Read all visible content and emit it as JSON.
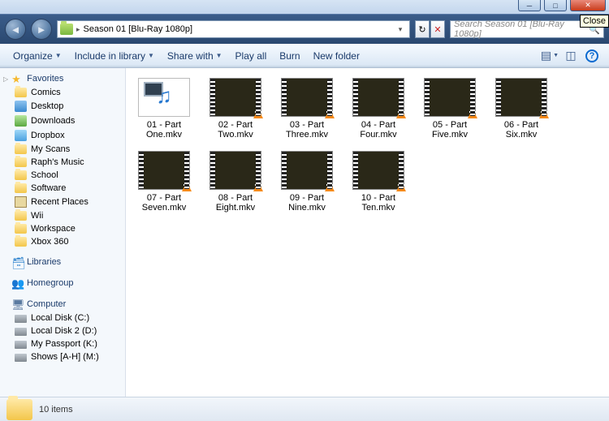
{
  "window": {
    "minimize_glyph": "─",
    "maximize_glyph": "□",
    "close_glyph": "✕",
    "close_tooltip": "Close"
  },
  "address": {
    "nav_back_glyph": "◄",
    "nav_fwd_glyph": "►",
    "path_sep": "▸",
    "current_folder": "Season 01 [Blu-Ray 1080p]",
    "dropdown_glyph": "▾",
    "refresh_glyph": "↻",
    "stop_glyph": "✕",
    "search_placeholder": "Search Season 01 [Blu-Ray 1080p]",
    "search_glyph": "🔍"
  },
  "toolbar": {
    "organize": "Organize",
    "include": "Include in library",
    "share": "Share with",
    "play": "Play all",
    "burn": "Burn",
    "newfolder": "New folder",
    "dd": "▼"
  },
  "sidebar": {
    "favorites": {
      "label": "Favorites",
      "items": [
        {
          "label": "Comics",
          "icon": "fold"
        },
        {
          "label": "Desktop",
          "icon": "desk"
        },
        {
          "label": "Downloads",
          "icon": "dl"
        },
        {
          "label": "Dropbox",
          "icon": "box"
        },
        {
          "label": "My Scans",
          "icon": "fold"
        },
        {
          "label": "Raph's Music",
          "icon": "fold"
        },
        {
          "label": "School",
          "icon": "fold"
        },
        {
          "label": "Software",
          "icon": "fold"
        },
        {
          "label": "Recent Places",
          "icon": "rec"
        },
        {
          "label": "Wii",
          "icon": "fold"
        },
        {
          "label": "Workspace",
          "icon": "fold"
        },
        {
          "label": "Xbox 360",
          "icon": "fold"
        }
      ]
    },
    "libraries": {
      "label": "Libraries"
    },
    "homegroup": {
      "label": "Homegroup"
    },
    "computer": {
      "label": "Computer",
      "items": [
        {
          "label": "Local Disk (C:)"
        },
        {
          "label": "Local Disk 2 (D:)"
        },
        {
          "label": "My Passport (K:)"
        },
        {
          "label": "Shows [A-H] (M:)"
        }
      ]
    }
  },
  "files": [
    {
      "name": "01 - Part One.mkv",
      "first": true
    },
    {
      "name": "02 - Part Two.mkv"
    },
    {
      "name": "03 - Part Three.mkv"
    },
    {
      "name": "04 - Part Four.mkv"
    },
    {
      "name": "05 - Part Five.mkv"
    },
    {
      "name": "06 - Part Six.mkv"
    },
    {
      "name": "07 - Part Seven.mkv"
    },
    {
      "name": "08 - Part Eight.mkv"
    },
    {
      "name": "09 - Part Nine.mkv"
    },
    {
      "name": "10 - Part Ten.mkv"
    }
  ],
  "status": {
    "text": "10 items"
  }
}
